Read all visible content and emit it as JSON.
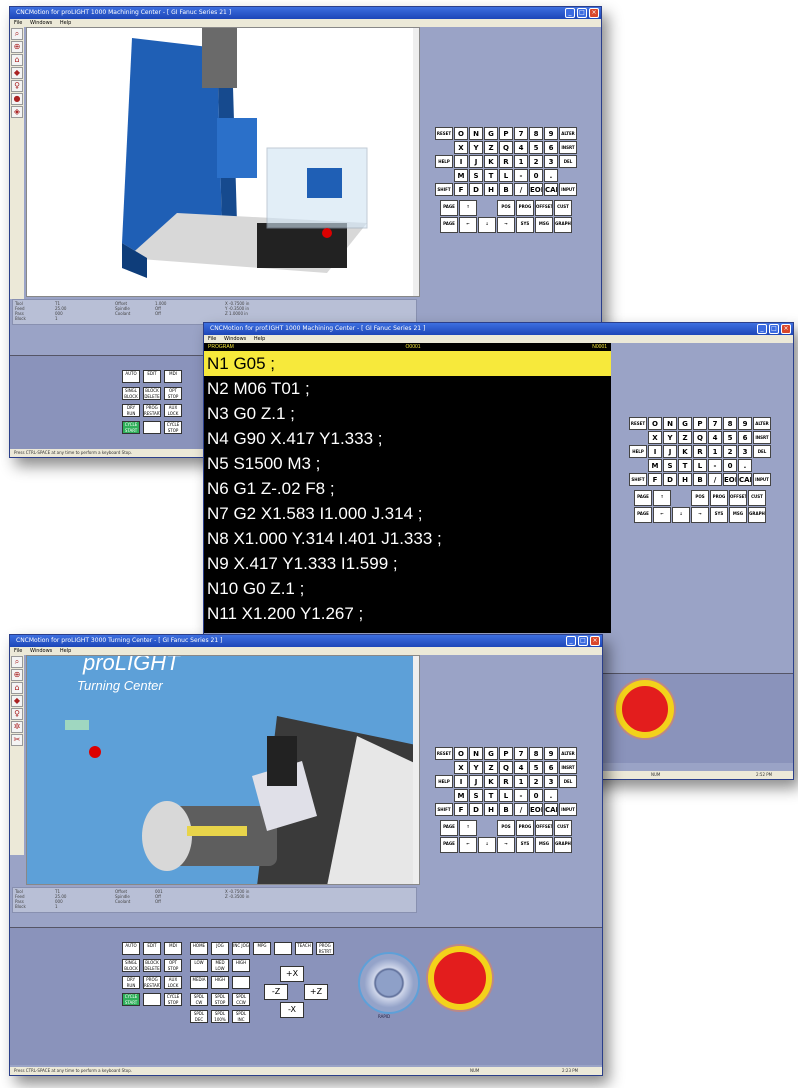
{
  "mill_window": {
    "title": "CNCMotion for proLIGHT 1000 Machining Center - [ GI Fanuc Series 21 ]",
    "menu": [
      "File",
      "Windows",
      "Help"
    ],
    "tools": [
      "magnifier-icon",
      "zoom-icon",
      "home-icon",
      "paint-icon",
      "light-icon",
      "stop-icon",
      "record-icon"
    ],
    "info_rows": [
      [
        "Tool",
        "T1",
        "Offset",
        "1.000",
        "X -0.7500 in"
      ],
      [
        "Feed",
        "25.00",
        "Spindle",
        "Off",
        "Y -0.3500 in"
      ],
      [
        "Pass",
        "000",
        "Coolant",
        "Off",
        "Z 1.0000 in"
      ],
      [
        "Block",
        "1",
        "",
        "",
        ""
      ]
    ],
    "controls": [
      [
        "AUTO",
        "EDIT",
        "MDI"
      ],
      [
        "SINGL BLOCK",
        "BLOCK DELETE",
        "OPT STOP"
      ],
      [
        "DRY RUN",
        "PROG RESTART",
        "AUX LOCK"
      ],
      [
        "CYCLE START",
        "",
        "CYCLE STOP"
      ]
    ],
    "status": "Press CTRL-SPACE at any time to perform a keyboard Stop."
  },
  "program_window": {
    "title": "CNCMotion for prof.IGHT 1000 Machining Center - [ GI Fanuc Series 21 ]",
    "menu": [
      "File",
      "Windows",
      "Help"
    ],
    "header_left": "PROGRAM",
    "header_mid": "O0001",
    "header_right": "N0001",
    "lines": [
      "N1 G05 ;",
      "N2 M06 T01 ;",
      "N3 G0 Z.1 ;",
      "N4 G90 X.417 Y1.333 ;",
      "N5 S1500 M3 ;",
      "N6 G1 Z-.02 F8 ;",
      "N7 G2 X1.583 I1.000 J.314 ;",
      "N8 X1.000 Y.314 I.401 J1.333 ;",
      "N9 X.417 Y1.333 I1.599 ;",
      "N10 G0 Z.1 ;",
      "N11 X1.200 Y1.267 ;"
    ],
    "status_num": "NUM",
    "status_time": "2:52 PM"
  },
  "lathe_window": {
    "title": "CNCMotion for proLIGHT 3000 Turning Center - [ GI Fanuc Series 21 ]",
    "menu": [
      "File",
      "Windows",
      "Help"
    ],
    "brand": "proLIGHT",
    "subtitle": "Turning Center",
    "info_rows": [
      [
        "Tool",
        "T1",
        "Offset",
        "001",
        "X -0.7500 in"
      ],
      [
        "Feed",
        "25.00",
        "Spindle",
        "Off",
        "Z -0.3500 in"
      ],
      [
        "Pass",
        "000",
        "Coolant",
        "Off",
        ""
      ],
      [
        "Block",
        "1",
        "",
        "",
        ""
      ]
    ],
    "controls_a": [
      [
        "AUTO",
        "EDIT",
        "MDI"
      ],
      [
        "SINGL BLOCK",
        "BLOCK DELETE",
        "OPT STOP"
      ],
      [
        "DRY RUN",
        "PROG RESTART",
        "AUX LOCK"
      ],
      [
        "CYCLE START",
        "",
        "CYCLE STOP"
      ]
    ],
    "controls_b": [
      [
        "HOME",
        "JOG",
        "INC JOG",
        "MPG",
        "",
        "TEACH",
        "PROG RSTRT"
      ],
      [
        "LOW",
        "MED LOW",
        "HIGH"
      ],
      [
        "MEDIA",
        "HIGH",
        ""
      ],
      [
        "SPDL CW",
        "SPDL STOP",
        "SPDL CCW"
      ],
      [
        "SPDL DEC",
        "SPDL 100%",
        "SPDL INC"
      ]
    ],
    "jog": [
      "+X",
      "-Z",
      "+Z",
      "-X"
    ],
    "dial_label": "RAPID",
    "status": "Press CTRL-SPACE at any time to perform a keyboard Stop.",
    "status_num": "NUM",
    "status_time": "2:23 PM"
  },
  "keypad": {
    "rows": [
      [
        "RESET",
        "O",
        "N",
        "G",
        "P",
        "7",
        "8",
        "9",
        "ALTER"
      ],
      [
        "",
        "X",
        "Y",
        "Z",
        "Q",
        "4",
        "5",
        "6",
        "INSRT"
      ],
      [
        "HELP",
        "I",
        "J",
        "K",
        "R",
        "1",
        "2",
        "3",
        "DEL"
      ],
      [
        "",
        "M",
        "S",
        "T",
        "L",
        "-",
        "0",
        ".",
        ""
      ],
      [
        "SHIFT",
        "F",
        "D",
        "H",
        "B",
        "/",
        "EOB",
        "CAN",
        "INPUT"
      ]
    ],
    "nav_rows": [
      [
        "PAGE ▲",
        "↑",
        "",
        "POS",
        "PROG",
        "OFFSET SETT.",
        "CUST"
      ],
      [
        "PAGE ▼",
        "←",
        "↓",
        "→",
        "SYS",
        "MSG",
        "GRAPH"
      ]
    ]
  },
  "colors": {
    "panel": "#9aa3c6",
    "titlebar": "#2453c8",
    "highlight": "#f7e93b",
    "estop": "#e31d1d",
    "estop_ring": "#f3d21b",
    "cycle_start": "#2fb05a"
  }
}
